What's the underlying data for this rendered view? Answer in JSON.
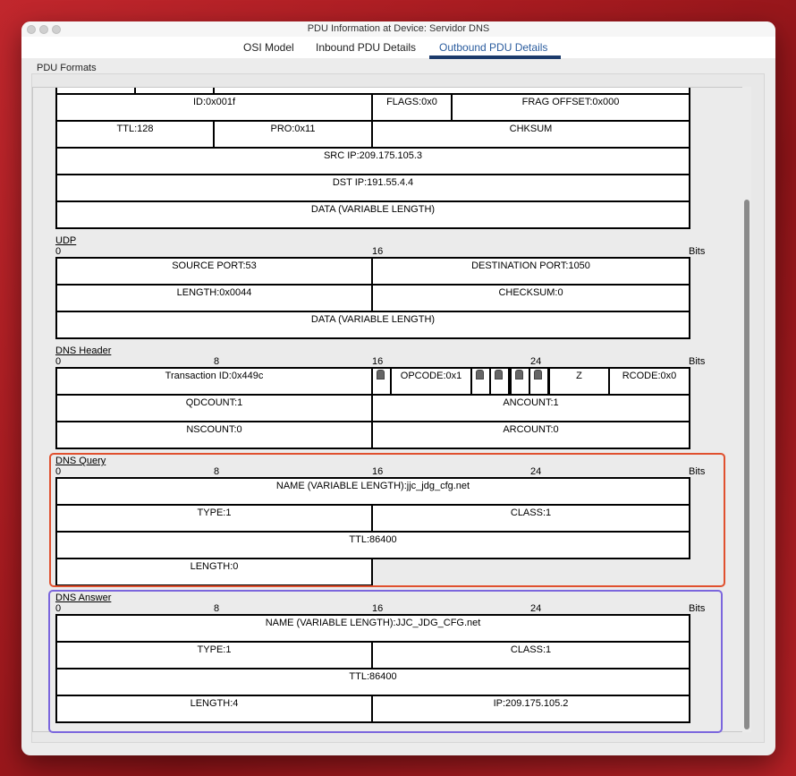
{
  "window": {
    "title": "PDU Information at Device: Servidor DNS"
  },
  "tabs": [
    {
      "label": "OSI Model"
    },
    {
      "label": "Inbound PDU Details"
    },
    {
      "label": "Outbound PDU Details"
    }
  ],
  "panel_label": "PDU Formats",
  "ip": {
    "id": "ID:0x001f",
    "flags": "FLAGS:0x0",
    "frag": "FRAG OFFSET:0x000",
    "ttl": "TTL:128",
    "pro": "PRO:0x11",
    "chksum": "CHKSUM",
    "src": "SRC IP:209.175.105.3",
    "dst": "DST IP:191.55.4.4",
    "data": "DATA (VARIABLE LENGTH)"
  },
  "udp": {
    "title": "UDP",
    "scale": {
      "s0": "0",
      "s16": "16",
      "bits": "Bits"
    },
    "src_port": "SOURCE PORT:53",
    "dst_port": "DESTINATION PORT:1050",
    "length": "LENGTH:0x0044",
    "checksum": "CHECKSUM:0",
    "data": "DATA (VARIABLE LENGTH)"
  },
  "dns_header": {
    "title": "DNS Header",
    "scale": {
      "s0": "0",
      "s8": "8",
      "s16": "16",
      "s24": "24",
      "bits": "Bits"
    },
    "transaction": "Transaction ID:0x449c",
    "opcode": "OPCODE:0x1",
    "z": "Z",
    "rcode": "RCODE:0x0",
    "qdcount": "QDCOUNT:1",
    "ancount": "ANCOUNT:1",
    "nscount": "NSCOUNT:0",
    "arcount": "ARCOUNT:0"
  },
  "dns_query": {
    "title": "DNS Query",
    "scale": {
      "s0": "0",
      "s8": "8",
      "s16": "16",
      "s24": "24",
      "bits": "Bits"
    },
    "name": "NAME (VARIABLE LENGTH):jjc_jdg_cfg.net",
    "type": "TYPE:1",
    "class": "CLASS:1",
    "ttl": "TTL:86400",
    "length": "LENGTH:0"
  },
  "dns_answer": {
    "title": "DNS Answer",
    "scale": {
      "s0": "0",
      "s8": "8",
      "s16": "16",
      "s24": "24",
      "bits": "Bits"
    },
    "name": "NAME (VARIABLE LENGTH):JJC_JDG_CFG.net",
    "type": "TYPE:1",
    "class": "CLASS:1",
    "ttl": "TTL:86400",
    "length": "LENGTH:4",
    "ip": "IP:209.175.105.2"
  },
  "colors": {
    "query_highlight": "#e0502e",
    "answer_highlight": "#7b66dd",
    "active_tab_underline": "#1b3a6b"
  }
}
